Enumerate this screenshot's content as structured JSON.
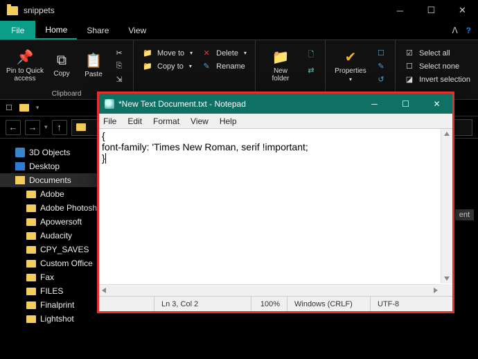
{
  "explorer": {
    "title": "snippets",
    "tabs": {
      "file": "File",
      "home": "Home",
      "share": "Share",
      "view": "View"
    },
    "ribbon": {
      "pin": "Pin to Quick\naccess",
      "copy": "Copy",
      "paste": "Paste",
      "clipboard_label": "Clipboard",
      "move_to": "Move to",
      "copy_to": "Copy to",
      "delete": "Delete",
      "rename": "Rename",
      "new_folder": "New\nfolder",
      "properties": "Properties",
      "select_all": "Select all",
      "select_none": "Select none",
      "invert_selection": "Invert selection"
    },
    "tree": [
      {
        "icon": "3d",
        "label": "3D Objects",
        "sub": false
      },
      {
        "icon": "desk",
        "label": "Desktop",
        "sub": false
      },
      {
        "icon": "doc",
        "label": "Documents",
        "sub": false,
        "active": true
      },
      {
        "icon": "fold",
        "label": "Adobe",
        "sub": true
      },
      {
        "icon": "fold",
        "label": "Adobe Photosh",
        "sub": true
      },
      {
        "icon": "fold",
        "label": "Apowersoft",
        "sub": true
      },
      {
        "icon": "fold",
        "label": "Audacity",
        "sub": true
      },
      {
        "icon": "fold",
        "label": "CPY_SAVES",
        "sub": true
      },
      {
        "icon": "fold",
        "label": "Custom Office",
        "sub": true
      },
      {
        "icon": "fold",
        "label": "Fax",
        "sub": true
      },
      {
        "icon": "fold",
        "label": "FILES",
        "sub": true
      },
      {
        "icon": "fold",
        "label": "Finalprint",
        "sub": true
      },
      {
        "icon": "fold",
        "label": "Lightshot",
        "sub": true
      }
    ],
    "content_partial": "ent"
  },
  "notepad": {
    "title": "*New Text Document.txt - Notepad",
    "menu": [
      "File",
      "Edit",
      "Format",
      "View",
      "Help"
    ],
    "content_lines": [
      "{",
      "font-family: 'Times New Roman, serif !important;",
      "}"
    ],
    "status": {
      "lncol": "Ln 3, Col 2",
      "zoom": "100%",
      "eol": "Windows (CRLF)",
      "encoding": "UTF-8"
    }
  }
}
